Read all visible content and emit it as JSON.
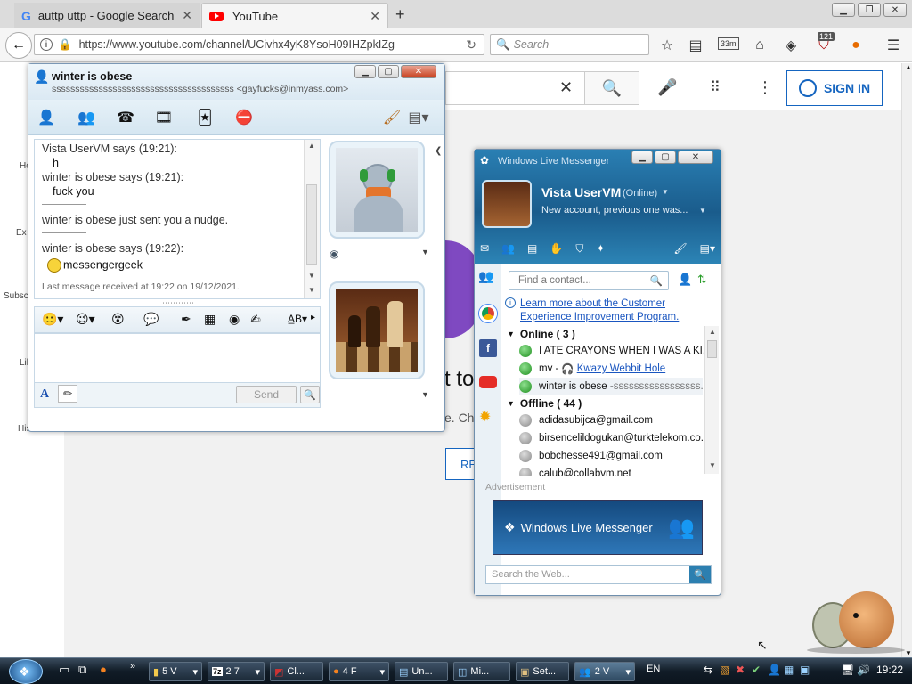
{
  "browser": {
    "tabs": [
      {
        "label": "auttp uttp - Google Search",
        "icon": "google-g-icon"
      },
      {
        "label": "YouTube",
        "icon": "youtube-icon"
      }
    ],
    "url": "https://www.youtube.com/channel/UCivhx4yK8YsoH09IHZpkIZg",
    "search_placeholder": "Search",
    "badge_count": "121",
    "extension_label": "33m"
  },
  "youtube": {
    "sign_in": "SIGN IN",
    "sidebar_labels": [
      "Ho",
      "Ex",
      "Subscr",
      "Lib",
      "Hist"
    ],
    "partial_heading": "t to",
    "partial_text": "e. Che",
    "partial_button": "RE"
  },
  "conversation": {
    "title": "winter is obese",
    "subtitle": "sssssssssssssssssssssssssssssssssssssss <gayfucks@inmyass.com>",
    "messages": {
      "m1_header": "Vista UserVM says (19:21):",
      "m1_text": "h",
      "m2_header": "winter is obese says (19:21):",
      "m2_text": "fuck you",
      "nudge": "winter is obese just sent you a nudge.",
      "m3_header": "winter is obese says (19:22):",
      "m3_text": "messengergeek"
    },
    "last_message": "Last message received at 19:22 on 19/12/2021.",
    "send": "Send"
  },
  "messenger": {
    "window_title": "Windows Live Messenger",
    "user_name": "Vista UserVM",
    "user_status": "(Online)",
    "user_message": "New account, previous one was...",
    "find_placeholder": "Find a contact...",
    "ceip_link": "Learn more about the Customer Experience Improvement Program.",
    "online_group": "Online ( 3 )",
    "offline_group": "Offline ( 44 )",
    "online_contacts": [
      {
        "name": "I ATE CRAYONS WHEN I WAS A KI...",
        "extra": ""
      },
      {
        "name": "mv - ",
        "extra": "Kwazy Webbit Hole"
      },
      {
        "name": "winter is obese - ",
        "extra": "sssssssssssssssss..."
      }
    ],
    "offline_contacts": [
      "adidasubijca@gmail.com",
      "birsencelildogukan@turktelekom.co...",
      "bobchesse491@gmail.com",
      "calub@collabvm.net"
    ],
    "advertisement": "Advertisement",
    "ad_text": "Windows Live Messenger",
    "web_search_placeholder": "Search the Web..."
  },
  "taskbar": {
    "items": [
      {
        "label": "5 V",
        "icon": "folder-icon"
      },
      {
        "label": "2 7",
        "icon": "7zip-icon"
      },
      {
        "label": "Cl...",
        "icon": "app-icon"
      },
      {
        "label": "4 F",
        "icon": "firefox-icon"
      },
      {
        "label": "Un...",
        "icon": "notepad-icon"
      },
      {
        "label": "Mi...",
        "icon": "app-icon"
      },
      {
        "label": "Set...",
        "icon": "setup-icon"
      },
      {
        "label": "2 V",
        "icon": "messenger-icon"
      }
    ],
    "language": "EN",
    "clock": "19:22"
  }
}
